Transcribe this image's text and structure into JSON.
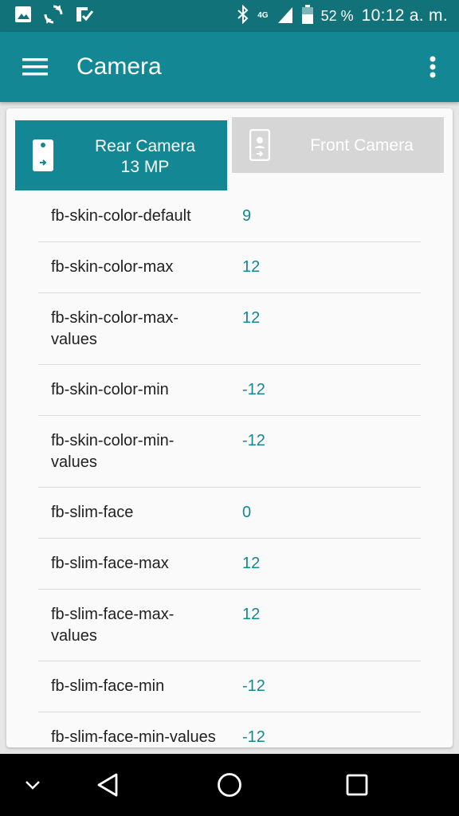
{
  "status_bar": {
    "battery_percent": "52 %",
    "time": "10:12 a. m.",
    "network": "4G",
    "icons": [
      "image-icon",
      "sync-icon",
      "checklist-icon",
      "bluetooth-icon",
      "signal-icon",
      "battery-icon"
    ]
  },
  "app_bar": {
    "title": "Camera",
    "menu_icon": "hamburger-menu-icon",
    "more_icon": "more-vert-icon"
  },
  "tabs": {
    "rear": {
      "line1": "Rear Camera",
      "line2": "13 MP",
      "selected": true
    },
    "front": {
      "label": "Front Camera",
      "selected": false
    }
  },
  "properties": [
    {
      "key": "fb-skin-color-default",
      "value": "9"
    },
    {
      "key": "fb-skin-color-max",
      "value": "12"
    },
    {
      "key": "fb-skin-color-max-values",
      "key_line1": "fb-skin-color-max-",
      "key_line2": "values",
      "value": "12"
    },
    {
      "key": "fb-skin-color-min",
      "value": "-12"
    },
    {
      "key": "fb-skin-color-min-values",
      "key_line1": "fb-skin-color-min-",
      "key_line2": "values",
      "value": "-12"
    },
    {
      "key": "fb-slim-face",
      "value": "0"
    },
    {
      "key": "fb-slim-face-max",
      "value": "12"
    },
    {
      "key": "fb-slim-face-max-values",
      "key_line1": "fb-slim-face-max-",
      "key_line2": "values",
      "value": "12"
    },
    {
      "key": "fb-slim-face-min",
      "value": "-12"
    },
    {
      "key": "fb-slim-face-min-values",
      "value": "-12"
    }
  ],
  "colors": {
    "status_bar": "#11727a",
    "app_bar": "#138894",
    "value_text": "#138894",
    "inactive_tab": "#d6d6d6"
  },
  "nav_bar": {
    "icons": [
      "chevron-down-icon",
      "back-icon",
      "home-icon",
      "recents-icon"
    ]
  }
}
